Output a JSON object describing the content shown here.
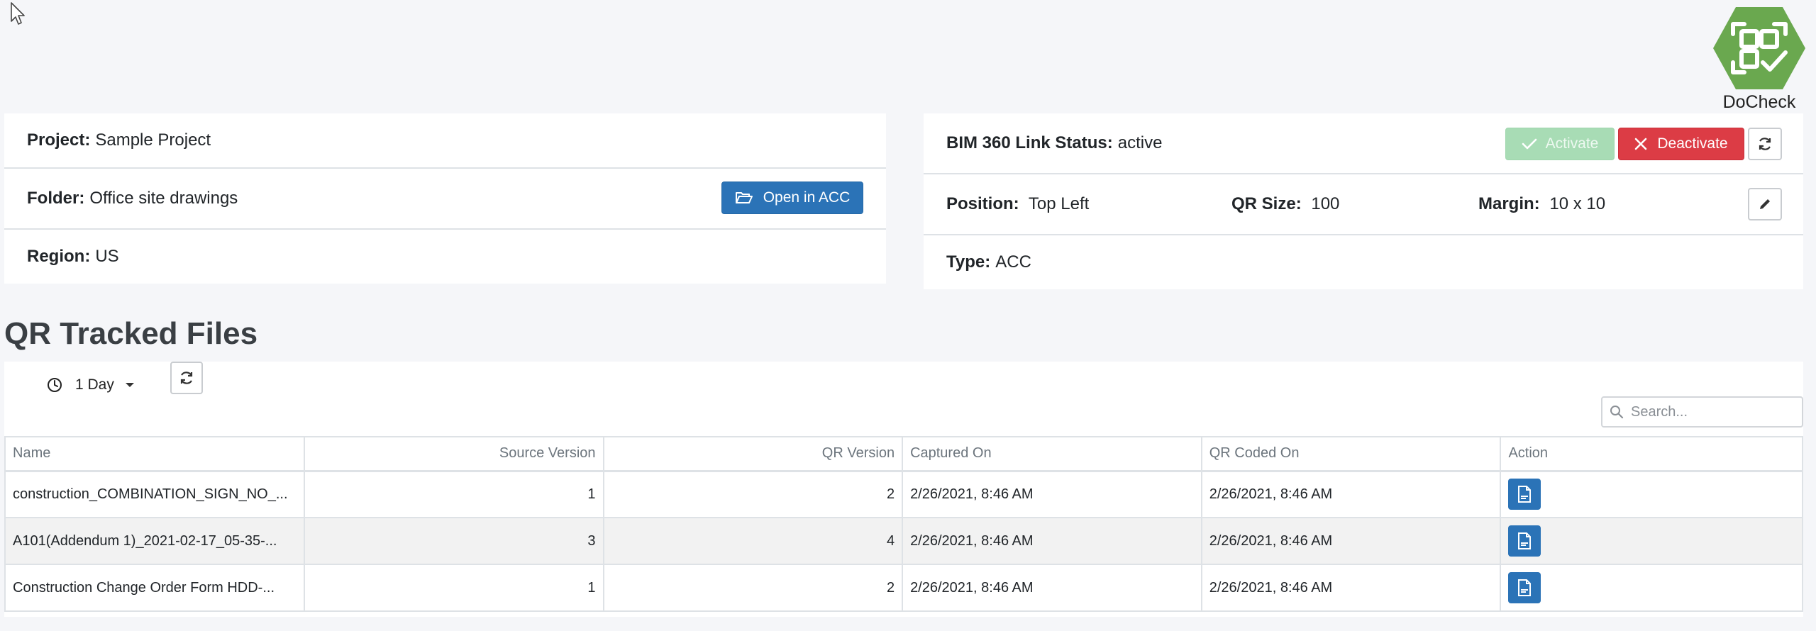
{
  "brand": {
    "name": "DoCheck",
    "color": "#6aa84f"
  },
  "project_panel": {
    "project_label": "Project:",
    "project_value": "Sample Project",
    "folder_label": "Folder:",
    "folder_value": "Office site drawings",
    "open_button": "Open in ACC",
    "region_label": "Region:",
    "region_value": "US"
  },
  "link_panel": {
    "status_label": "BIM 360 Link Status:",
    "status_value": "active",
    "activate_button": "Activate",
    "deactivate_button": "Deactivate",
    "position_label": "Position:",
    "position_value": "Top Left",
    "qr_size_label": "QR Size:",
    "qr_size_value": "100",
    "margin_label": "Margin:",
    "margin_value": "10 x 10",
    "type_label": "Type:",
    "type_value": "ACC"
  },
  "files": {
    "title": "QR Tracked Files",
    "period": "1 Day",
    "search_placeholder": "Search...",
    "columns": [
      "Name",
      "Source Version",
      "QR Version",
      "Captured On",
      "QR Coded On",
      "Action"
    ],
    "rows": [
      {
        "name": "construction_COMBINATION_SIGN_NO_...",
        "source_version": "1",
        "qr_version": "2",
        "captured_on": "2/26/2021, 8:46 AM",
        "qr_coded_on": "2/26/2021, 8:46 AM"
      },
      {
        "name": "A101(Addendum 1)_2021-02-17_05-35-...",
        "source_version": "3",
        "qr_version": "4",
        "captured_on": "2/26/2021, 8:46 AM",
        "qr_coded_on": "2/26/2021, 8:46 AM"
      },
      {
        "name": "Construction Change Order Form HDD-...",
        "source_version": "1",
        "qr_version": "2",
        "captured_on": "2/26/2021, 8:46 AM",
        "qr_coded_on": "2/26/2021, 8:46 AM"
      }
    ]
  },
  "colors": {
    "primary": "#2b73b7",
    "danger": "#dc3c45",
    "success_disabled": "#a8dcb5"
  }
}
